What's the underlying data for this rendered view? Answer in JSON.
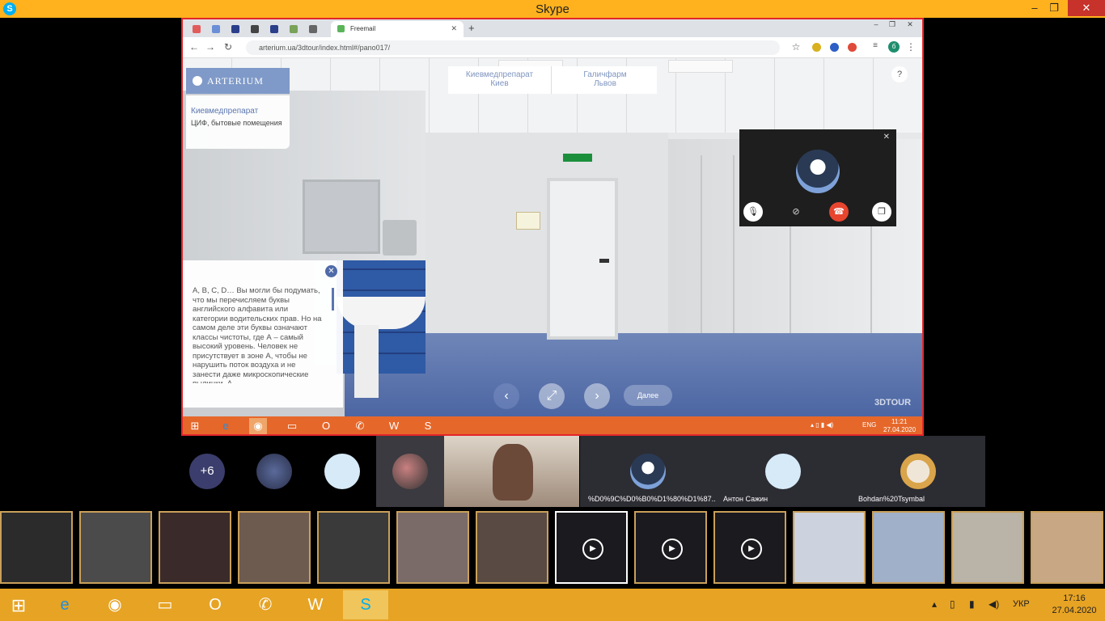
{
  "window": {
    "title": "Skype",
    "controls": [
      "–",
      "❐",
      "✕"
    ]
  },
  "browser": {
    "active_tab_title": "Freemail",
    "url": "arterium.ua/3dtour/index.html#/pano017/",
    "profile_initial": "б"
  },
  "tour": {
    "brand": "ARTERIUM",
    "location_title": "Киевмедпрепарат",
    "location_subtitle": "ЦИФ, бытовые помещения",
    "tabs": [
      {
        "line1": "Киевмедпрепарат",
        "line2": "Киев"
      },
      {
        "line1": "Галичфарм",
        "line2": "Львов"
      }
    ],
    "info_text": "А, В, С, D… Вы могли бы подумать, что мы перечисляем буквы английского алфавита или категории водительских прав. Но на самом деле эти буквы означают классы чистоты, где А – самый высокий уровень. Человек не присутствует в зоне А, чтобы не нарушить поток воздуха и не занести даже микроскопические пылинки. А",
    "next_label": "Далее",
    "watermark": "3DTOUR",
    "help": "?"
  },
  "inner_taskbar": {
    "lang": "ENG",
    "time": "11:21",
    "date": "27.04.2020"
  },
  "participants": {
    "more_count": "+6",
    "tiles": [
      {
        "name": "%D0%9C%D0%B0%D1%80%D1%87..."
      },
      {
        "name": "Антон Сажин"
      },
      {
        "name": "Bohdan%20Tsymbal"
      }
    ]
  },
  "taskbar": {
    "lang": "УКР",
    "time": "17:16",
    "date": "27.04.2020"
  },
  "colors": {
    "skype_title_bar": "#ffb21e",
    "share_border": "#e3262a",
    "taskbar": "#e7a323",
    "inner_taskbar": "#e6672a",
    "arterium_accent": "#5a76b0"
  }
}
